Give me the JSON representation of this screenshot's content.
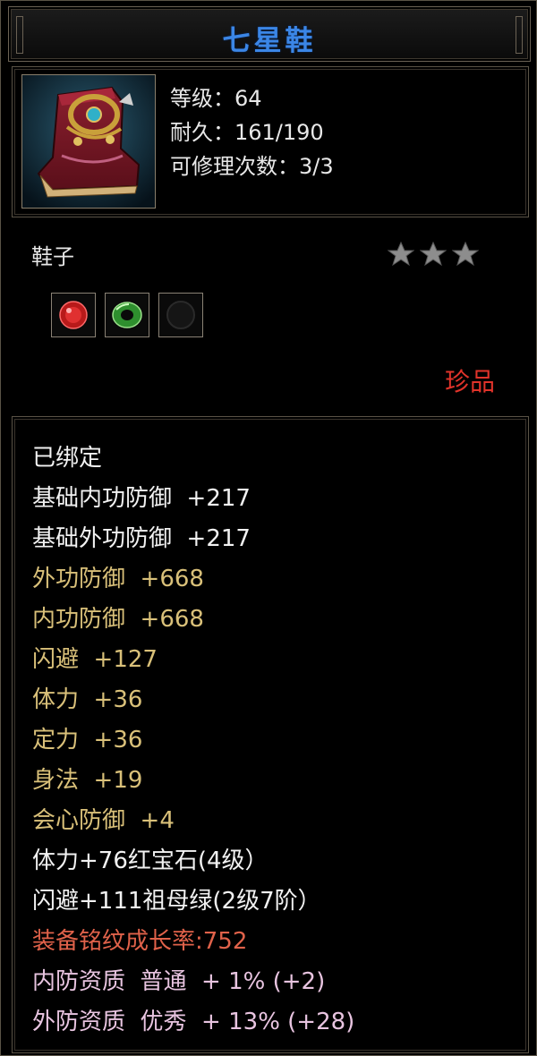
{
  "item": {
    "name": "七星鞋",
    "level_line": "等级：64",
    "durability_line": "耐久：161/190",
    "repair_line": "可修理次数：3/3",
    "type": "鞋子",
    "stars": 3,
    "rarity": "珍品",
    "icon": "boot-icon",
    "sockets": [
      {
        "icon": "ruby-gem-icon",
        "color": "#d42a2a"
      },
      {
        "icon": "emerald-gem-icon",
        "color": "#3aa83a"
      },
      {
        "icon": "empty-socket-icon",
        "color": "#1a1a1a"
      }
    ]
  },
  "attributes": [
    {
      "text": "已绑定",
      "color": "white"
    },
    {
      "text": "基础内功防御  +217",
      "color": "white"
    },
    {
      "text": "基础外功防御  +217",
      "color": "white"
    },
    {
      "text": "外功防御  +668",
      "color": "gold"
    },
    {
      "text": "内功防御  +668",
      "color": "gold"
    },
    {
      "text": "闪避  +127",
      "color": "gold"
    },
    {
      "text": "体力  +36",
      "color": "gold"
    },
    {
      "text": "定力  +36",
      "color": "gold"
    },
    {
      "text": "身法  +19",
      "color": "gold"
    },
    {
      "text": "会心防御  +4",
      "color": "gold"
    },
    {
      "text": "体力+76红宝石(4级）",
      "color": "white"
    },
    {
      "text": "闪避+111祖母绿(2级7阶）",
      "color": "white"
    },
    {
      "text": "装备铭纹成长率:752",
      "color": "red"
    },
    {
      "text": "内防资质  普通  + 1% (+2)",
      "color": "pink"
    },
    {
      "text": "外防资质  优秀  + 13% (+28)",
      "color": "pink"
    }
  ],
  "colors": {
    "title": "#3b86e6",
    "rarity": "#e0332a",
    "white": "#f2f2f2",
    "gold": "#d9c079",
    "red": "#e0624a",
    "pink": "#e8c4e0"
  }
}
